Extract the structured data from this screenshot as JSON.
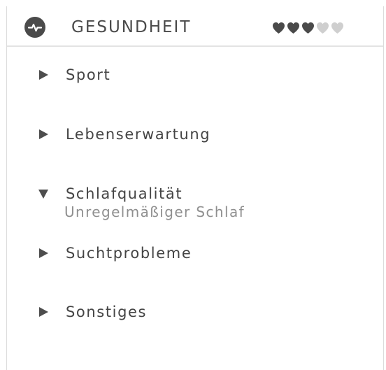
{
  "colors": {
    "text": "#444444",
    "heart_filled": "#4a4a4a",
    "heart_empty": "#cfcfcf",
    "subtext": "#8f8f8f"
  },
  "header": {
    "icon": "heartbeat-icon",
    "title": "GESUNDHEIT",
    "rating": {
      "filled": 3,
      "total": 5
    }
  },
  "items": [
    {
      "label": "Sport",
      "expanded": false
    },
    {
      "label": "Lebenserwartung",
      "expanded": false
    },
    {
      "label": "Schlafqualität",
      "expanded": true,
      "detail": "Unregelmäßiger Schlaf"
    },
    {
      "label": "Suchtprobleme",
      "expanded": false
    },
    {
      "label": "Sonstiges",
      "expanded": false
    }
  ]
}
